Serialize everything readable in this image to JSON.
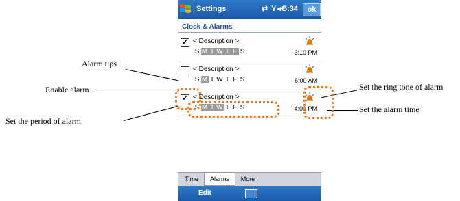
{
  "annotations": {
    "alarm_tips": "Alarm tips",
    "enable_alarm": "Enable alarm",
    "set_period": "Set the period of alarm",
    "set_ring_tone": "Set the ring tone of alarm",
    "set_alarm_time": "Set the alarm time"
  },
  "titlebar": {
    "title": "Settings",
    "status_icons": "⇄ Y◂€",
    "clock": "5:34",
    "ok": "ok"
  },
  "section_title": "Clock & Alarms",
  "alarms": [
    {
      "enabled": true,
      "check": "✓",
      "description": "< Description >",
      "days": [
        "S",
        "M",
        "T",
        "W",
        "T",
        "F",
        "S"
      ],
      "active_days": [
        false,
        true,
        true,
        true,
        true,
        true,
        false
      ],
      "time": "3:10 PM"
    },
    {
      "enabled": false,
      "check": "",
      "description": "< Description >",
      "days": [
        "S",
        "M",
        "T",
        "W",
        "T",
        "F",
        "S"
      ],
      "active_days": [
        false,
        true,
        false,
        false,
        false,
        false,
        false
      ],
      "time": "6:00 AM"
    },
    {
      "enabled": true,
      "check": "✓",
      "description": "< Description >",
      "days": [
        "S",
        "M",
        "T",
        "W",
        "T",
        "F",
        "S"
      ],
      "active_days": [
        false,
        true,
        true,
        true,
        false,
        false,
        false
      ],
      "time": "4:00 PM"
    }
  ],
  "tabs": [
    "Time",
    "Alarms",
    "More"
  ],
  "active_tab": "Alarms",
  "menubar": {
    "edit": "Edit",
    "keyboard_icon": "keyboard-icon"
  },
  "colors": {
    "titlebar": "#1a5aa8",
    "highlight_ring": "#f07b1c",
    "active_day": "#9a9a9a"
  }
}
